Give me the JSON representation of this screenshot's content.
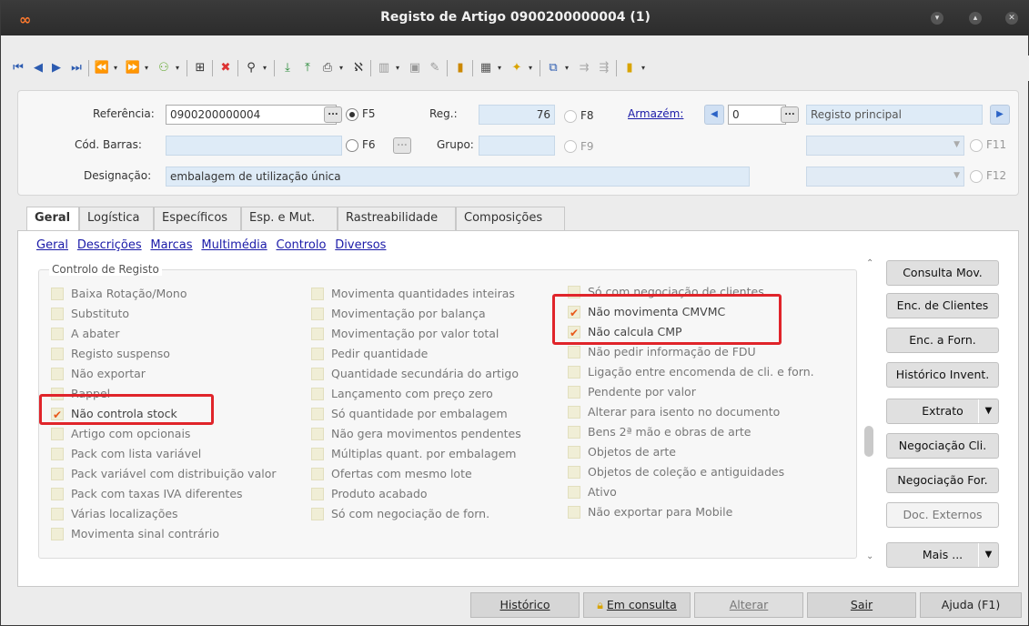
{
  "window": {
    "title": "Registo de Artigo 0900200000004 (1)"
  },
  "header": {
    "referencia_label": "Referência:",
    "referencia_value": "0900200000004",
    "f5": "F5",
    "reg_label": "Reg.:",
    "reg_value": "76",
    "f8": "F8",
    "armazem_label": "Armazém:",
    "armazem_value": "0",
    "armazem_name": "Registo principal",
    "codbarras_label": "Cód. Barras:",
    "f6": "F6",
    "grupo_label": "Grupo:",
    "f9": "F9",
    "f11": "F11",
    "designacao_label": "Designação:",
    "designacao_value": "embalagem de utilização única",
    "f12": "F12"
  },
  "tabs": [
    {
      "label": "Geral"
    },
    {
      "label": "Logística"
    },
    {
      "label": "Específicos"
    },
    {
      "label": "Esp. e Mut."
    },
    {
      "label": "Rastreabilidade"
    },
    {
      "label": "Composições"
    }
  ],
  "subnav": [
    {
      "label": "Geral"
    },
    {
      "label": "Descrições"
    },
    {
      "label": "Marcas"
    },
    {
      "label": "Multimédia"
    },
    {
      "label": "Controlo"
    },
    {
      "label": "Diversos"
    }
  ],
  "group_title": "Controlo de Registo",
  "col1": [
    {
      "label": "Baixa Rotação/Mono",
      "checked": false
    },
    {
      "label": "Substituto",
      "checked": false
    },
    {
      "label": "A abater",
      "checked": false
    },
    {
      "label": "Registo suspenso",
      "checked": false
    },
    {
      "label": "Não exportar",
      "checked": false
    },
    {
      "label": "Rappel",
      "checked": false
    },
    {
      "label": "Não controla stock",
      "checked": true
    },
    {
      "label": "Artigo com opcionais",
      "checked": false
    },
    {
      "label": "Pack com lista variável",
      "checked": false
    },
    {
      "label": "Pack variável com distribuição valor",
      "checked": false
    },
    {
      "label": "Pack com taxas IVA diferentes",
      "checked": false
    },
    {
      "label": "Várias localizações",
      "checked": false
    },
    {
      "label": "Movimenta sinal contrário",
      "checked": false
    }
  ],
  "col2": [
    {
      "label": "Movimenta quantidades inteiras",
      "checked": false
    },
    {
      "label": "Movimentação por balança",
      "checked": false
    },
    {
      "label": "Movimentação por valor total",
      "checked": false
    },
    {
      "label": "Pedir quantidade",
      "checked": false
    },
    {
      "label": "Quantidade secundária do artigo",
      "checked": false
    },
    {
      "label": "Lançamento com preço zero",
      "checked": false
    },
    {
      "label": "Só quantidade por embalagem",
      "checked": false
    },
    {
      "label": "Não gera movimentos pendentes",
      "checked": false
    },
    {
      "label": "Múltiplas quant. por embalagem",
      "checked": false
    },
    {
      "label": "Ofertas com mesmo lote",
      "checked": false
    },
    {
      "label": "Produto acabado",
      "checked": false
    },
    {
      "label": "Só com negociação de forn.",
      "checked": false
    }
  ],
  "col3": [
    {
      "label": "Só com negociação de clientes",
      "checked": false
    },
    {
      "label": "Não movimenta CMVMC",
      "checked": true
    },
    {
      "label": "Não calcula CMP",
      "checked": true
    },
    {
      "label": "Não pedir informação de FDU",
      "checked": false
    },
    {
      "label": "Ligação entre encomenda de cli. e forn.",
      "checked": false
    },
    {
      "label": "Pendente por valor",
      "checked": false
    },
    {
      "label": "Alterar para isento no documento",
      "checked": false
    },
    {
      "label": "Bens 2ª mão e obras de arte",
      "checked": false
    },
    {
      "label": "Objetos de arte",
      "checked": false
    },
    {
      "label": "Objetos de coleção e antiguidades",
      "checked": false
    },
    {
      "label": "Ativo",
      "checked": false
    },
    {
      "label": "Não exportar para Mobile",
      "checked": false
    }
  ],
  "side_buttons": {
    "consulta_mov": "Consulta Mov.",
    "enc_clientes": "Enc. de Clientes",
    "enc_forn": "Enc. a Forn.",
    "historico_invent": "Histórico Invent.",
    "extrato": "Extrato",
    "negociacao_cli": "Negociação Cli.",
    "negociacao_for": "Negociação For.",
    "doc_externos": "Doc. Externos",
    "mais": "Mais ..."
  },
  "bottom": {
    "historico": "Histórico",
    "em_consulta": "Em consulta",
    "alterar": "Alterar",
    "sair": "Sair",
    "ajuda": "Ajuda (F1)"
  },
  "colors": {
    "accent": "#1a1aa8",
    "check": "#e8591a",
    "highlight": "#e0242a"
  }
}
